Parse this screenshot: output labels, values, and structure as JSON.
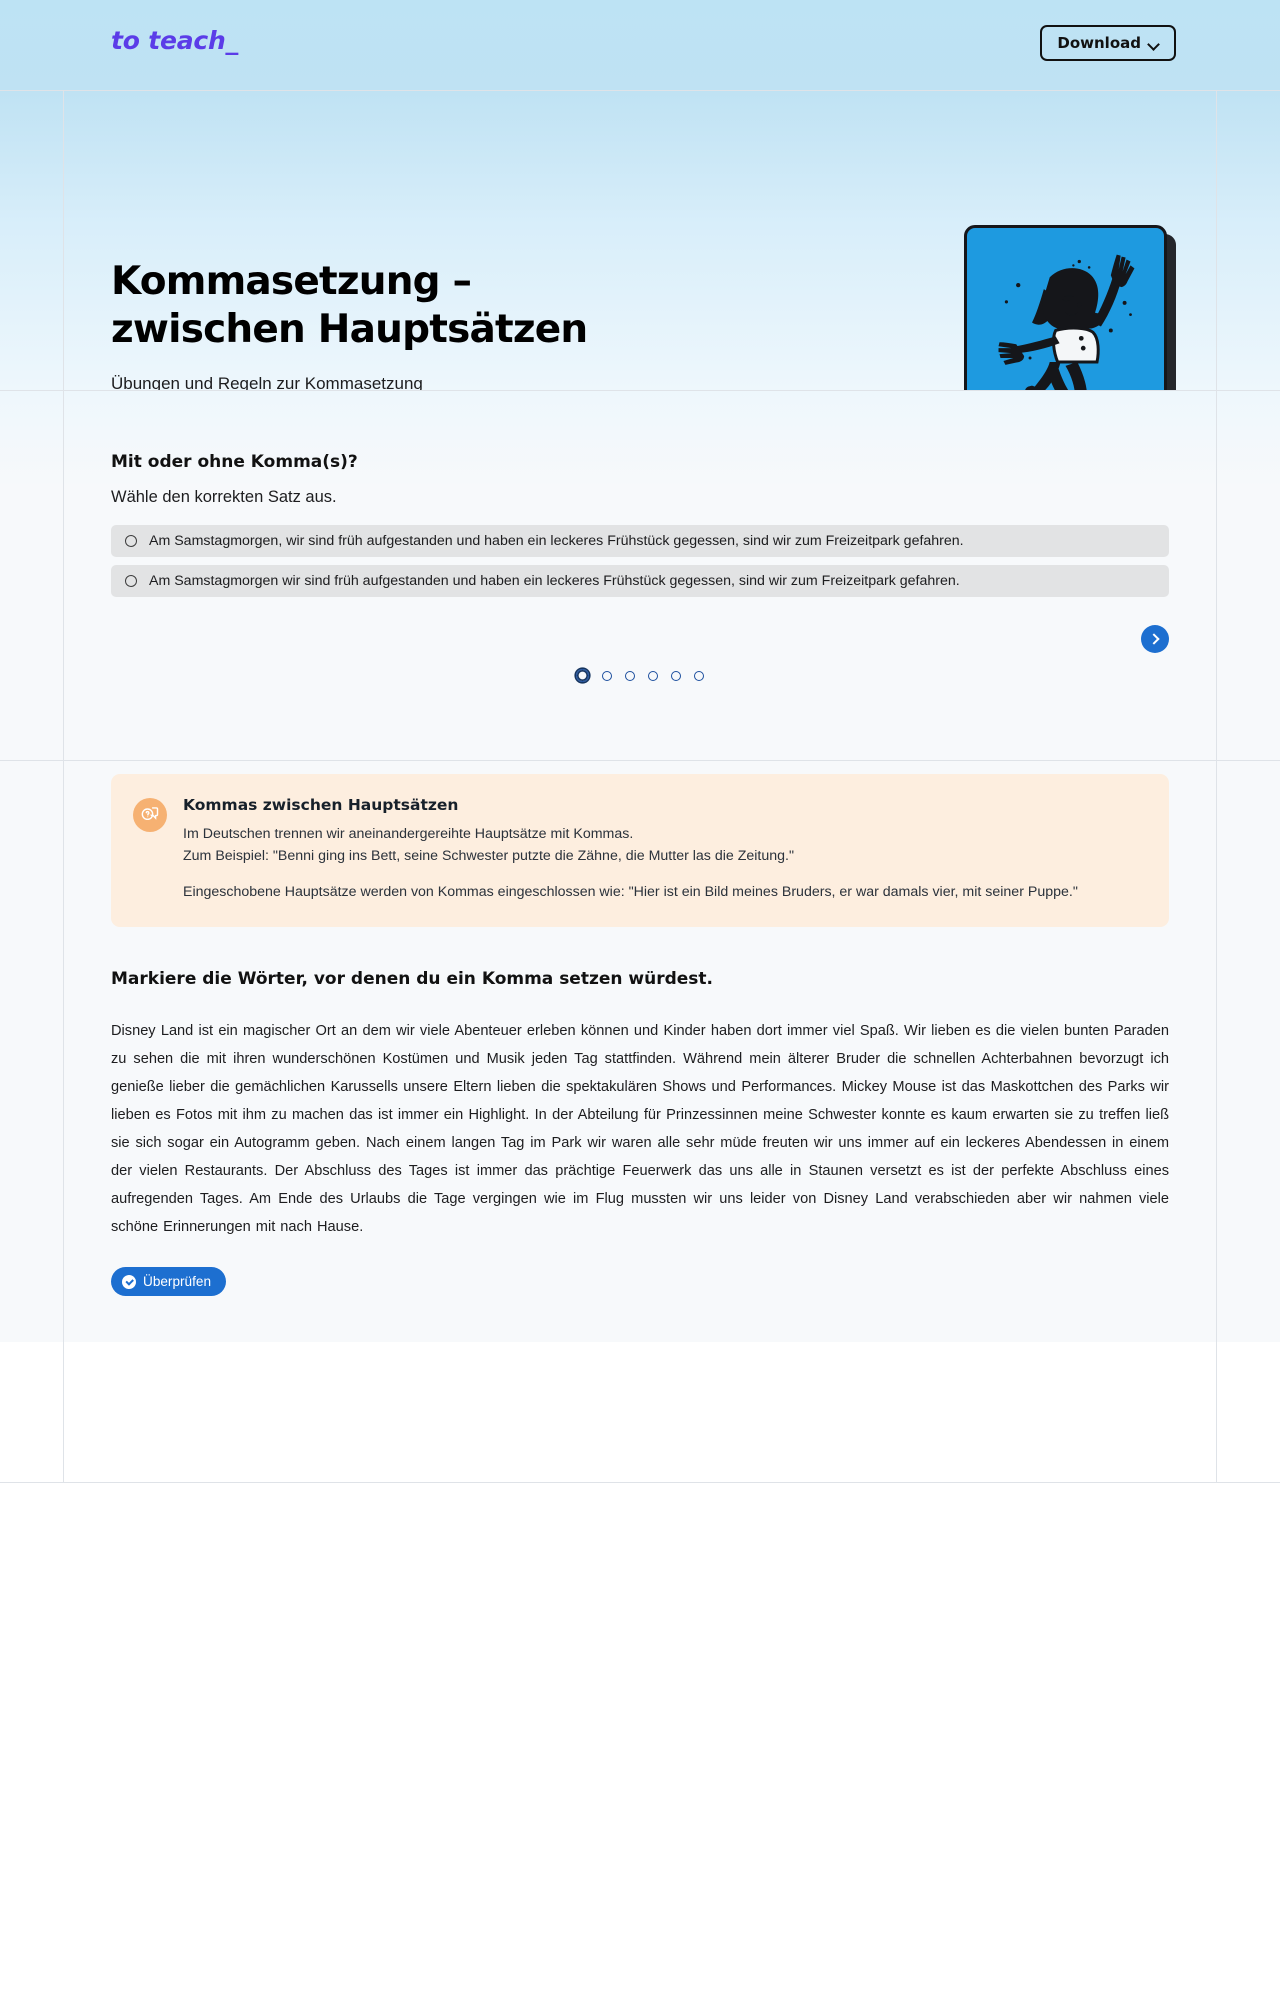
{
  "header": {
    "brand": "to teach_",
    "download_label": "Download",
    "chevron_icon": "chevron-down-icon"
  },
  "hero": {
    "title": "Kommasetzung –\nzwischen Hauptsätzen",
    "subtitle": "Übungen und Regeln zur Kommasetzung",
    "illustration_name": "jumping-girl-illustration",
    "illustration_bg": "#1e9ae0"
  },
  "quiz": {
    "heading": "Mit oder ohne Komma(s)?",
    "instruction": "Wähle den korrekten Satz aus.",
    "options": [
      {
        "label": "Am Samstagmorgen, wir sind früh aufgestanden und haben ein leckeres Frühstück gegessen, sind wir zum Freizeitpark gefahren.",
        "selected": false
      },
      {
        "label": "Am Samstagmorgen wir sind früh aufgestanden und haben ein leckeres Frühstück gegessen, sind wir zum Freizeitpark gefahren.",
        "selected": false
      }
    ],
    "next_icon": "chevron-right-icon",
    "pagination": {
      "total": 6,
      "current": 1
    }
  },
  "info": {
    "icon": "question-speech-bubble-icon",
    "icon_bg": "#f6b172",
    "box_bg": "#fdeedf",
    "title": "Kommas zwischen Hauptsätzen",
    "paragraph_1": "Im Deutschen trennen wir aneinandergereihte Hauptsätze mit Kommas.\nZum Beispiel: \"Benni ging ins Bett, seine Schwester putzte die Zähne, die Mutter las die Zeitung.\"",
    "paragraph_2": "Eingeschobene Hauptsätze werden von Kommas eingeschlossen wie: \"Hier ist ein Bild meines Bruders, er war damals vier, mit seiner Puppe.\""
  },
  "exercise": {
    "heading": "Markiere die Wörter, vor denen du ein Komma setzen würdest.",
    "text": "Disney Land ist ein magischer Ort an dem wir viele Abenteuer erleben können und Kinder haben dort immer viel Spaß. Wir lieben es die vielen bunten Paraden zu sehen die mit ihren wunderschönen Kostümen und Musik jeden Tag stattfinden. Während mein älterer Bruder die schnellen Achterbahnen bevorzugt ich genieße lieber die gemächlichen Karussells unsere Eltern lieben die spektakulären Shows und Performances. Mickey Mouse ist das Maskottchen des Parks wir lieben es Fotos mit ihm zu machen das ist immer ein Highlight. In der Abteilung für Prinzessinnen meine Schwester konnte es kaum erwarten sie zu treffen ließ sie sich sogar ein Autogramm geben. Nach einem langen Tag im Park wir waren alle sehr müde freuten wir uns immer auf ein leckeres Abendessen in einem der vielen Restaurants. Der Abschluss des Tages ist immer das prächtige Feuerwerk das uns alle in Staunen versetzt es ist der perfekte Abschluss eines aufregenden Tages. Am Ende des Urlaubs die Tage vergingen wie im Flug mussten wir uns leider von Disney Land verabschieden aber wir nahmen viele schöne Erinnerungen mit nach Hause.",
    "check_label": "Überprüfen",
    "check_icon": "check-circle-icon",
    "accent_color": "#1d6fd0"
  }
}
